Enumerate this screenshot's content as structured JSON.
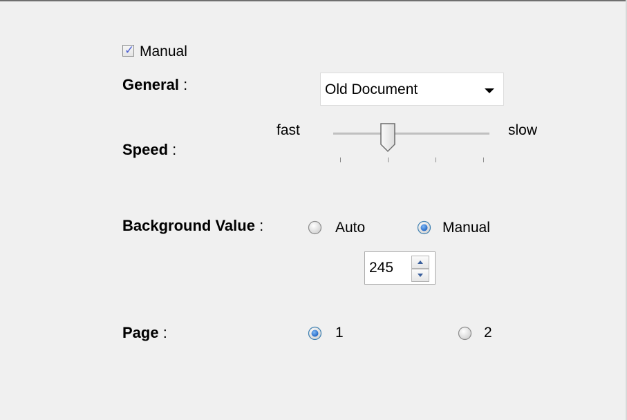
{
  "manual_checkbox": {
    "label": "Manual",
    "checked": true
  },
  "general": {
    "label": "General",
    "colon": ":",
    "selected": "Old Document"
  },
  "speed": {
    "label": "Speed",
    "colon": ":",
    "min_label": "fast",
    "max_label": "slow",
    "tick_count": 4,
    "value_fraction": 0.35
  },
  "background_value": {
    "label": "Background Value",
    "colon": ":",
    "options": [
      {
        "label": "Auto",
        "selected": false
      },
      {
        "label": "Manual",
        "selected": true
      }
    ],
    "value": "245"
  },
  "page": {
    "label": "Page",
    "colon": ":",
    "options": [
      {
        "label": "1",
        "selected": true
      },
      {
        "label": "2",
        "selected": false
      }
    ]
  },
  "colors": {
    "background": "#f0f0f0",
    "radio_selected": "#2a73d6",
    "check_mark": "#4b5ed1"
  }
}
